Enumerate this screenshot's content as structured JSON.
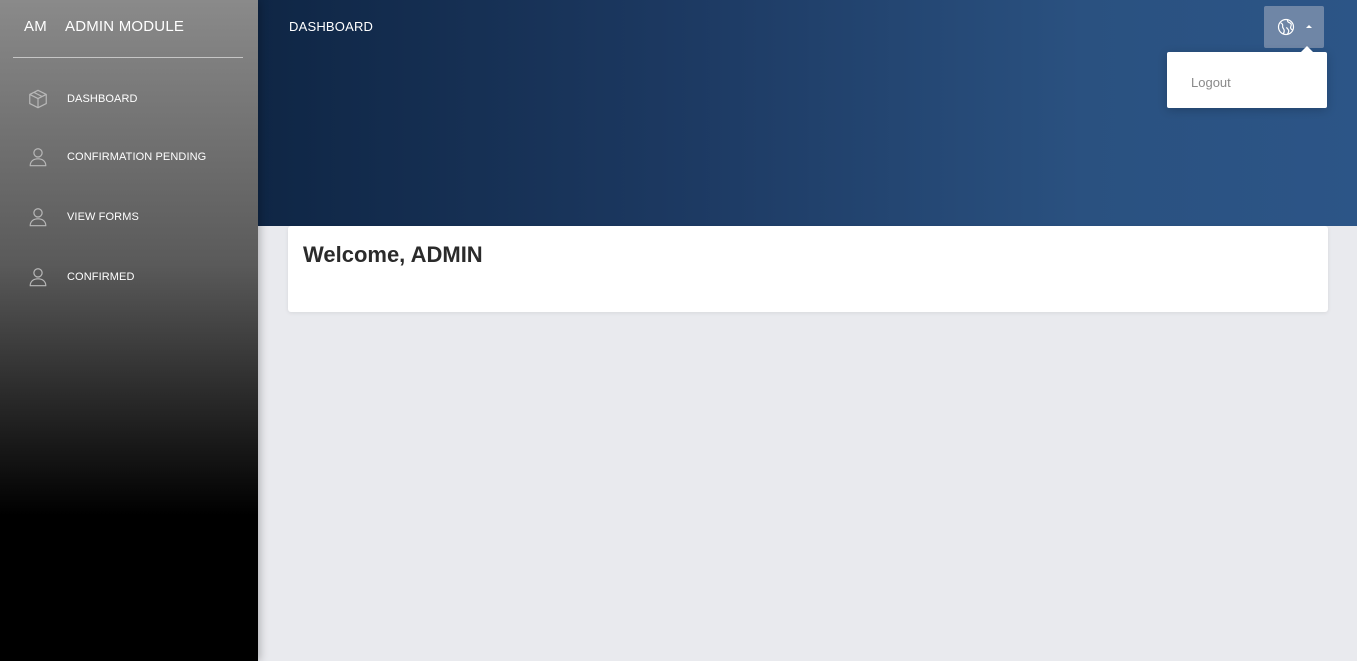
{
  "sidebar": {
    "brand_mini": "AM",
    "brand_name": "ADMIN MODULE",
    "items": [
      {
        "label": "DASHBOARD",
        "icon": "cube-icon"
      },
      {
        "label": "CONFIRMATION PENDING",
        "icon": "user-icon"
      },
      {
        "label": "VIEW FORMS",
        "icon": "user-icon"
      },
      {
        "label": "CONFIRMED",
        "icon": "user-icon"
      }
    ]
  },
  "header": {
    "title": "DASHBOARD",
    "user_menu_icon": "globe-icon"
  },
  "dropdown": {
    "items": [
      {
        "label": "Logout"
      }
    ]
  },
  "main": {
    "welcome": "Welcome, ADMIN"
  },
  "colors": {
    "header_start": "#0f2645",
    "header_end": "#2c5587",
    "content_bg": "#e9eaee",
    "user_button": "#6f86a6"
  }
}
